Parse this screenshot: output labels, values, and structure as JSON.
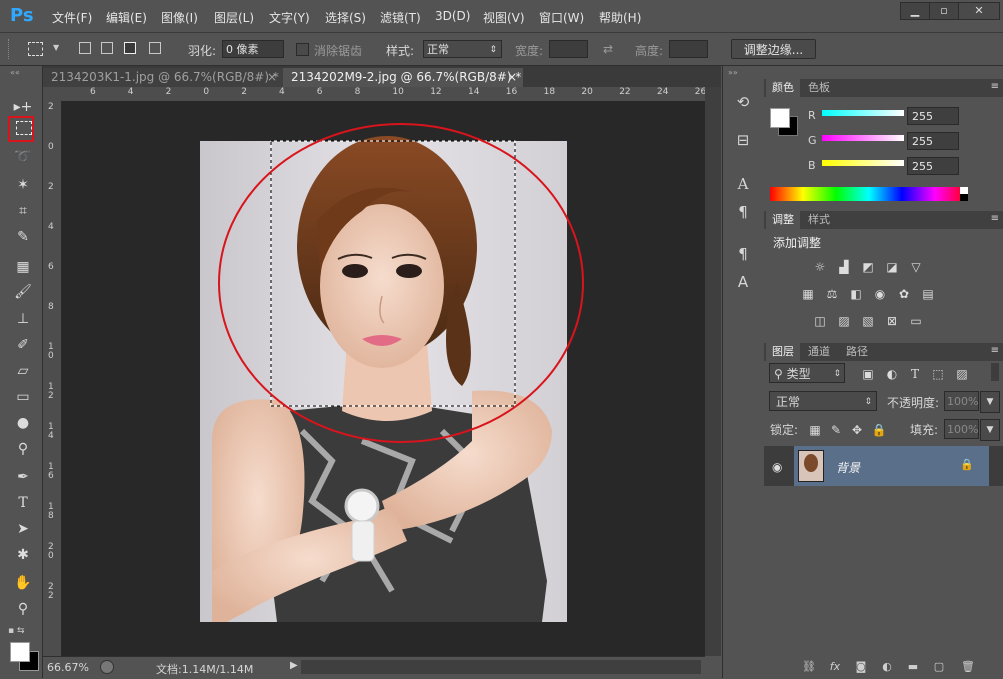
{
  "app": {
    "logo": "Ps"
  },
  "menu": [
    "文件(F)",
    "编辑(E)",
    "图像(I)",
    "图层(L)",
    "文字(Y)",
    "选择(S)",
    "滤镜(T)",
    "3D(D)",
    "视图(V)",
    "窗口(W)",
    "帮助(H)"
  ],
  "options": {
    "feather_label": "羽化:",
    "feather_value": "0 像素",
    "antialias_label": "消除锯齿",
    "style_label": "样式:",
    "style_value": "正常",
    "width_label": "宽度:",
    "height_label": "高度:",
    "refine_button": "调整边缘..."
  },
  "tabs": [
    {
      "label": "2134203K1-1.jpg @ 66.7%(RGB/8#) *",
      "close": "×",
      "active": false
    },
    {
      "label": "2134202M9-2.jpg @ 66.7%(RGB/8#) *",
      "close": "×",
      "active": true
    }
  ],
  "ruler": {
    "h": [
      "6",
      "4",
      "2",
      "0",
      "2",
      "4",
      "6",
      "8",
      "10",
      "12",
      "14",
      "16",
      "18",
      "20",
      "22",
      "24",
      "26"
    ],
    "v": [
      "2",
      "0",
      "2",
      "4",
      "6",
      "8",
      "1\n0",
      "1\n2",
      "1\n4",
      "1\n6",
      "1\n8",
      "2\n0",
      "2\n2"
    ]
  },
  "status": {
    "zoom": "66.67%",
    "doc": "文档:1.14M/1.14M"
  },
  "color_panel": {
    "tabs": [
      "颜色",
      "色板"
    ],
    "channels": [
      {
        "name": "R",
        "value": "255",
        "color": "#ff0000"
      },
      {
        "name": "G",
        "value": "255",
        "color": "#00ff00"
      },
      {
        "name": "B",
        "value": "255",
        "color": "#0000ff"
      }
    ]
  },
  "adjust_panel": {
    "tabs": [
      "调整",
      "样式"
    ],
    "title": "添加调整"
  },
  "layers_panel": {
    "tabs": [
      "图层",
      "通道",
      "路径"
    ],
    "filter_label": "类型",
    "blend_mode": "正常",
    "opacity_label": "不透明度:",
    "opacity_value": "100%",
    "lock_label": "锁定:",
    "fill_label": "填充:",
    "fill_value": "100%",
    "layer_name": "背景"
  },
  "colors": {
    "accent": "#31a8ff",
    "annotation_red": "#d8141c",
    "layer_selected": "#5a6f8a"
  }
}
